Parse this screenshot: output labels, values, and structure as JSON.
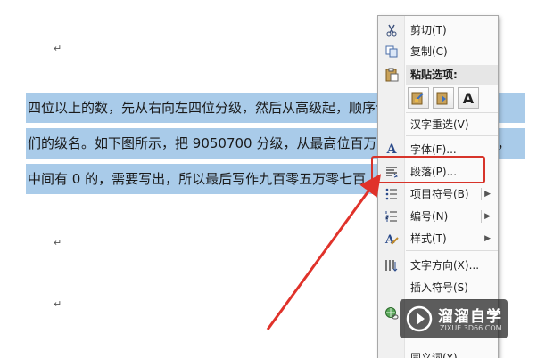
{
  "document": {
    "para_mark": "↵",
    "selected_lines": [
      "四位以上的数，先从右向左四位分级，然后从高级起，顺序读出各级里的数和它",
      "们的级名。如下图所示，把 9050700 分级，从最高位百万位起写，百万，十万，",
      "中间有 0 的，需要写出，所以最后写作九百零五万零七百。"
    ]
  },
  "context_menu": {
    "cut": "剪切(T)",
    "copy": "复制(C)",
    "paste_options": "粘贴选项:",
    "paste_text_only": "A",
    "hanzi_reselect": "汉字重选(V)",
    "font": "字体(F)...",
    "paragraph": "段落(P)...",
    "bullets": "项目符号(B)",
    "numbering": "编号(N)",
    "styles": "样式(T)",
    "text_direction": "文字方向(X)...",
    "insert_symbol": "插入符号(S)",
    "cutoff_item": "同义词(Y)"
  },
  "colors": {
    "selection": "#a9cbe9",
    "highlight": "#d7342a",
    "arrow": "#e0322a"
  },
  "watermark": {
    "title": "溜溜自学",
    "url": "ZIXUE.3D66.COM"
  }
}
